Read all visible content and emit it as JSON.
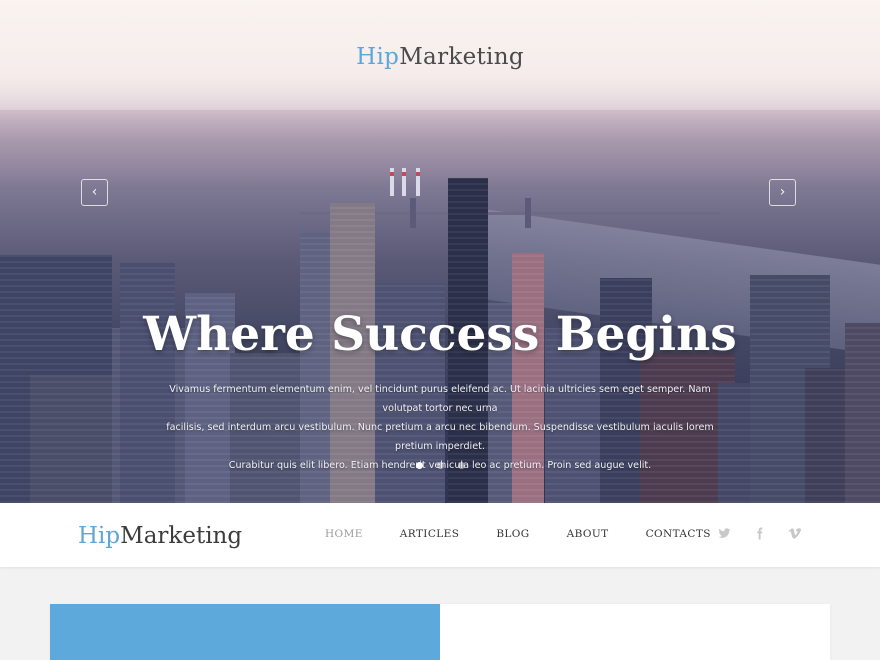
{
  "hero": {
    "logo": {
      "part1": "Hip",
      "part2": "Marketing"
    },
    "title": "Where Success Begins",
    "text_lines": [
      "Vivamus fermentum elementum enim, vel tincidunt purus eleifend ac. Ut lacinia ultricies sem eget semper. Nam volutpat tortor nec urna",
      "facilisis, sed interdum arcu vestibulum. Nunc pretium a arcu nec bibendum. Suspendisse vestibulum iaculis lorem pretium imperdiet.",
      "Curabitur quis elit libero. Etiam hendrerit vehicula leo ac pretium. Proin sed augue velit."
    ],
    "prev_icon": "‹",
    "next_icon": "›",
    "slides": {
      "count": 3,
      "active": 1
    }
  },
  "navbar": {
    "logo": {
      "part1": "Hip",
      "part2": "Marketing"
    },
    "menu": [
      {
        "label": "HOME",
        "active": true
      },
      {
        "label": "ARTICLES",
        "active": false
      },
      {
        "label": "BLOG",
        "active": false
      },
      {
        "label": "ABOUT",
        "active": false
      },
      {
        "label": "CONTACTS",
        "active": false
      }
    ],
    "social": [
      "twitter-icon",
      "facebook-icon",
      "vimeo-icon"
    ]
  },
  "colors": {
    "accent": "#5da7da",
    "nav_text": "#333333",
    "nav_active": "#9a9a9a",
    "social_icon": "#c8c8c8"
  }
}
